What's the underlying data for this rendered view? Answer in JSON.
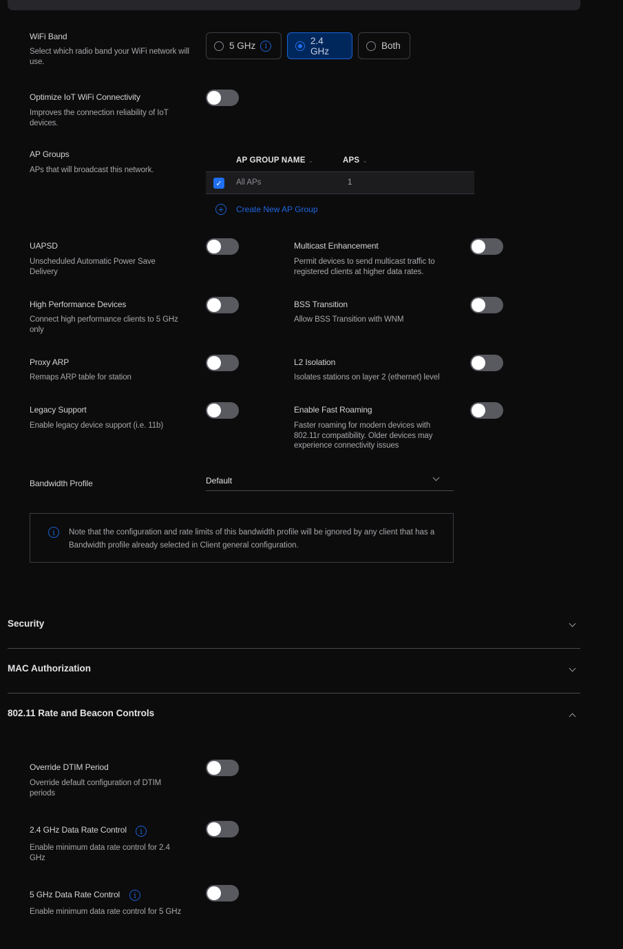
{
  "wifi_band": {
    "label": "WiFi Band",
    "description": "Select which radio band your WiFi network will use.",
    "options": [
      {
        "label": "5 GHz",
        "selected": false,
        "has_info": true
      },
      {
        "label": "2.4 GHz",
        "selected": true,
        "has_info": false
      },
      {
        "label": "Both",
        "selected": false,
        "has_info": false
      }
    ]
  },
  "iot": {
    "label": "Optimize IoT WiFi Connectivity",
    "description": "Improves the connection reliability of IoT devices.",
    "enabled": false
  },
  "ap_groups": {
    "label": "AP Groups",
    "description": "APs that will broadcast this network.",
    "columns": [
      "AP GROUP NAME",
      "APS"
    ],
    "rows": [
      {
        "name": "All APs",
        "aps": "1",
        "checked": true
      }
    ],
    "create_label": "Create New AP Group"
  },
  "toggles": [
    {
      "label": "UAPSD",
      "description": "Unscheduled Automatic Power Save Delivery",
      "enabled": false
    },
    {
      "label": "Multicast Enhancement",
      "description": "Permit devices to send multicast traffic to registered clients at higher data rates.",
      "enabled": false
    },
    {
      "label": "High Performance Devices",
      "description": "Connect high performance clients to 5 GHz only",
      "enabled": false
    },
    {
      "label": "BSS Transition",
      "description": "Allow BSS Transition with WNM",
      "enabled": false
    },
    {
      "label": "Proxy ARP",
      "description": "Remaps ARP table for station",
      "enabled": false
    },
    {
      "label": "L2 Isolation",
      "description": "Isolates stations on layer 2 (ethernet) level",
      "enabled": false
    },
    {
      "label": "Legacy Support",
      "description": "Enable legacy device support (i.e. 11b)",
      "enabled": false
    },
    {
      "label": "Enable Fast Roaming",
      "description": "Faster roaming for modern devices with 802.11r compatibility. Older devices may experience connectivity issues",
      "enabled": false
    }
  ],
  "bandwidth_profile": {
    "label": "Bandwidth Profile",
    "value": "Default",
    "note": "Note that the configuration and rate limits of this bandwidth profile will be ignored by any client that has a Bandwidth profile already selected in Client general configuration."
  },
  "sections": [
    {
      "title": "Security",
      "expanded": false
    },
    {
      "title": "MAC Authorization",
      "expanded": false
    },
    {
      "title": "802.11 Rate and Beacon Controls",
      "expanded": true
    }
  ],
  "rate_controls": [
    {
      "label": "Override DTIM Period",
      "description": "Override default configuration of DTIM periods",
      "enabled": false,
      "has_info": false
    },
    {
      "label": "2.4 GHz Data Rate Control",
      "description": "Enable minimum data rate control for 2.4 GHz",
      "enabled": false,
      "has_info": true
    },
    {
      "label": "5 GHz Data Rate Control",
      "description": "Enable minimum data rate control for 5 GHz",
      "enabled": false,
      "has_info": true
    }
  ],
  "colors": {
    "background": "#0c0c0d",
    "accent": "#1f6ff0",
    "selected_bg": "#00275c",
    "toggle_off": "#595a60"
  }
}
